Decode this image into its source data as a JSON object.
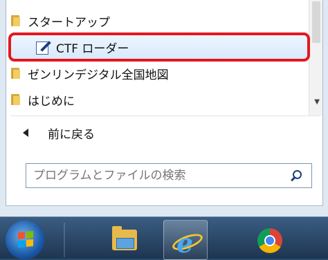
{
  "menu": {
    "items": [
      {
        "label": "スタートアップ",
        "icon": "folder-icon"
      },
      {
        "label": "CTF ローダー",
        "icon": "ctf-loader-icon",
        "selected": true
      },
      {
        "label": "ゼンリンデジタル全国地図",
        "icon": "folder-icon"
      },
      {
        "label": "はじめに",
        "icon": "folder-icon"
      }
    ],
    "back_label": "前に戻る",
    "search_placeholder": "プログラムとファイルの検索"
  },
  "taskbar": {
    "items": [
      {
        "name": "windows-explorer",
        "icon": "folder-icon"
      },
      {
        "name": "internet-explorer",
        "icon": "ie-icon",
        "active": true
      },
      {
        "name": "google-chrome",
        "icon": "chrome-icon"
      }
    ]
  },
  "colors": {
    "highlight": "#e4171e",
    "selection": "#d8e9fb",
    "taskbar": "#2b4a6a"
  }
}
